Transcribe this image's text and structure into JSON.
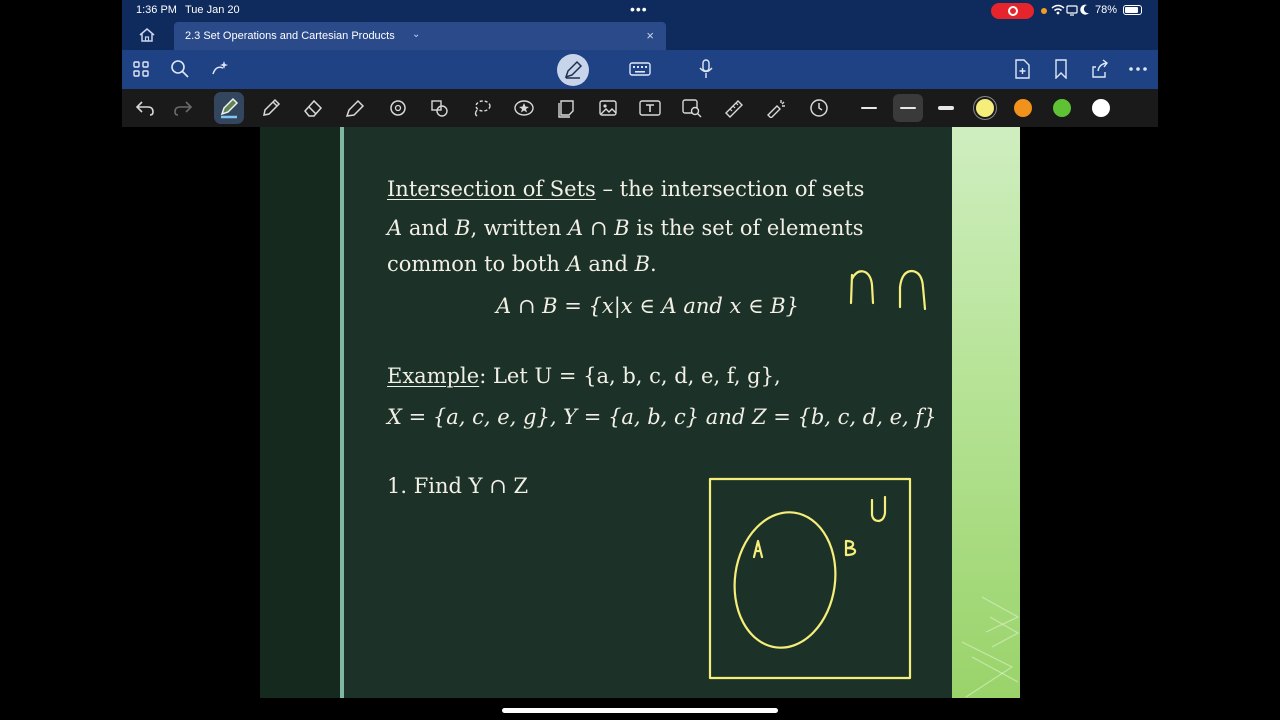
{
  "status": {
    "time": "1:36 PM",
    "date": "Tue Jan 20",
    "more": "•••",
    "battery_pct": "78%"
  },
  "tab": {
    "title": "2.3 Set Operations and Cartesian Products",
    "dropdown_glyph": "⌄",
    "close_glyph": "×"
  },
  "toolbar": {
    "left": [
      "home-icon",
      "grid-icon",
      "search-icon",
      "ai-sparkle-icon"
    ],
    "center": [
      "pen-mode-icon",
      "keyboard-icon",
      "microphone-icon"
    ],
    "right": [
      "add-page-icon",
      "bookmark-icon",
      "share-icon",
      "more-icon"
    ]
  },
  "tools": {
    "items": [
      "undo-icon",
      "redo-icon",
      "highlighter-pen-icon",
      "pencil-icon",
      "eraser-icon",
      "highlighter-icon",
      "shapes-icon",
      "lasso-icon",
      "lasso-select-icon",
      "sticker-icon",
      "sticky-note-icon",
      "image-icon",
      "text-box-icon",
      "image-search-icon",
      "ruler-icon",
      "laser-pointer-icon",
      "timer-icon"
    ],
    "strokes": [
      "thin",
      "medium",
      "thick"
    ],
    "colors": [
      "#f6ee7a",
      "#f0921c",
      "#5ec234",
      "#ffffff"
    ],
    "selected_color": "#f6ee7a"
  },
  "slide": {
    "def_title": "Intersection of Sets",
    "def_line1_rest": " – the intersection of sets",
    "def_line2_a": "A",
    "def_line2_and": " and ",
    "def_line2_b": "B",
    "def_line2_rest1": ", written ",
    "def_line2_expr": "A ∩ B",
    "def_line2_rest2": " is the set of elements",
    "def_line3_pre": "common to both ",
    "def_line3_a": "A",
    "def_line3_and": " and ",
    "def_line3_b": "B",
    "def_line3_end": ".",
    "formula": "A ∩ B = {x|x ∈ A and x ∈ B}",
    "example_label": "Example",
    "example_line1_rest": ": Let U = {a, b, c, d, e, f, g},",
    "example_line2": "X = {a, c, e, g}, Y = {a, b, c} and Z = {b, c, d, e, f}",
    "question": "1. Find Y ∩ Z"
  },
  "ink": {
    "color": "#f6ee7a",
    "symbols": "∩ ∩",
    "venn_label_a": "A",
    "venn_label_b": "B",
    "venn_label_u": "U"
  }
}
